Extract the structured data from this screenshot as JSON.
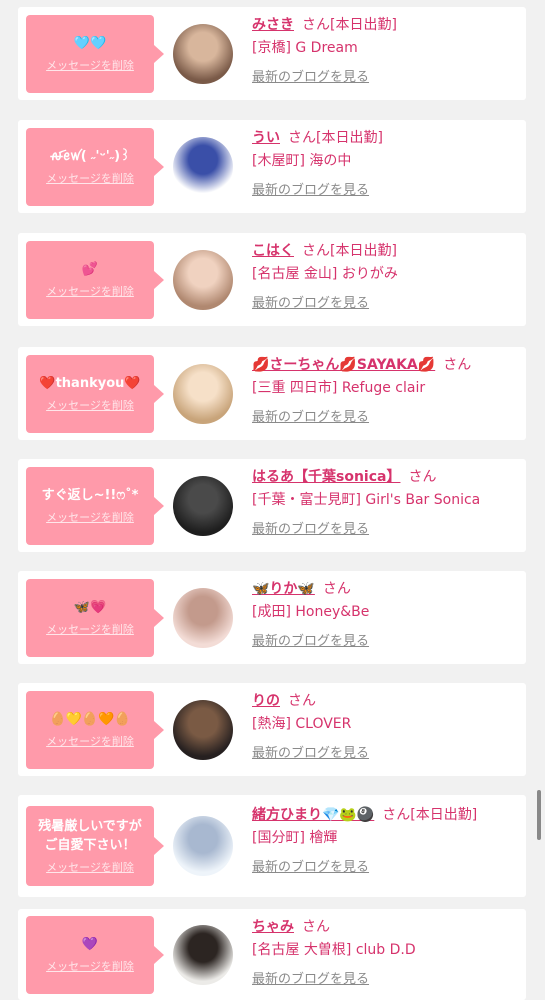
{
  "delete_label": "メッセージを削除",
  "san_label": "さん",
  "blog_label": "最新のブログを見る",
  "colors": {
    "bubble": "#ff9aaa",
    "accent": "#d6336c",
    "background": "#f1f1f1"
  },
  "items": [
    {
      "message": "🩵🩵",
      "name": "みさき",
      "status": "[本日出勤]",
      "shop": "[京橋] G Dream",
      "avatar_colors": [
        "#7a5a48",
        "#d8b69c"
      ]
    },
    {
      "message": "ꫛꫀꪝ( ˶'ᵕ'˶)꒱",
      "name": "うい",
      "status": "[本日出勤]",
      "shop": "[木屋町] 海の中",
      "avatar_colors": [
        "#ffffff",
        "#3a4fa8"
      ]
    },
    {
      "message": "💕",
      "name": "こはく",
      "status": "[本日出勤]",
      "shop": "[名古屋 金山] おりがみ",
      "avatar_colors": [
        "#b08870",
        "#f0d2c0"
      ]
    },
    {
      "message": "❤️thankyou❤️",
      "name": "💋さーちゃん💋SAYAKA💋",
      "status": "",
      "shop": "[三重 四日市] Refuge clair",
      "avatar_colors": [
        "#c8a47a",
        "#f6e0c8"
      ]
    },
    {
      "message": "すぐ返し~!!ෆ˚*",
      "name": "はるあ【千葉sonica】",
      "status": "",
      "shop": "[千葉・富士見町] Girl's Bar Sonica",
      "avatar_colors": [
        "#1e1e1e",
        "#4a4a4a"
      ]
    },
    {
      "message": "🦋💗",
      "name": "🦋りか🦋",
      "status": "",
      "shop": "[成田] Honey&Be",
      "avatar_colors": [
        "#f3dcd6",
        "#c39a8c"
      ]
    },
    {
      "message": "🥚💛🥚🧡🥚",
      "name": "りの",
      "status": "",
      "shop": "[熱海] CLOVER",
      "avatar_colors": [
        "#262020",
        "#7a5a44"
      ]
    },
    {
      "message": "残暑厳しいですが\nご自愛下さい！",
      "name": "緒方ひまり💎🐸🎱",
      "status": "[本日出勤]",
      "shop": "[国分町] 檜輝",
      "avatar_colors": [
        "#eef4fa",
        "#a8b8d0"
      ]
    },
    {
      "message": "💜",
      "name": "ちゃみ",
      "status": "",
      "shop": "[名古屋 大曽根] club D.D",
      "avatar_colors": [
        "#ecebe8",
        "#2c2522"
      ]
    }
  ]
}
